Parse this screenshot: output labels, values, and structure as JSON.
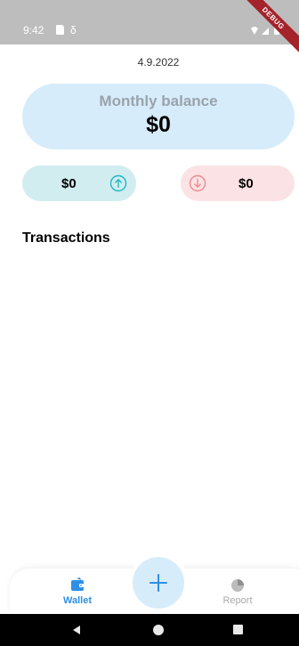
{
  "status_bar": {
    "time": "9:42",
    "glyph": "δ",
    "debug_label": "DEBUG",
    "icons": [
      "sd-card-icon",
      "wifi-icon",
      "signal-icon",
      "battery-icon"
    ]
  },
  "header": {
    "date": "4.9.2022"
  },
  "balance": {
    "label": "Monthly balance",
    "value": "$0"
  },
  "income": {
    "value": "$0",
    "icon": "arrow-up-circle-icon",
    "color": "#21b7c4"
  },
  "expense": {
    "value": "$0",
    "icon": "arrow-down-circle-icon",
    "color": "#f08a8f"
  },
  "transactions": {
    "title": "Transactions",
    "items": []
  },
  "bottom_nav": {
    "items": [
      {
        "label": "Wallet",
        "icon": "wallet-icon",
        "active": true
      },
      {
        "label": "Report",
        "icon": "pie-chart-icon",
        "active": false
      }
    ],
    "fab_icon": "plus-icon",
    "accent": "#2d8fe6"
  },
  "system_nav": {
    "icons": [
      "back-icon",
      "home-icon",
      "recents-icon"
    ]
  }
}
